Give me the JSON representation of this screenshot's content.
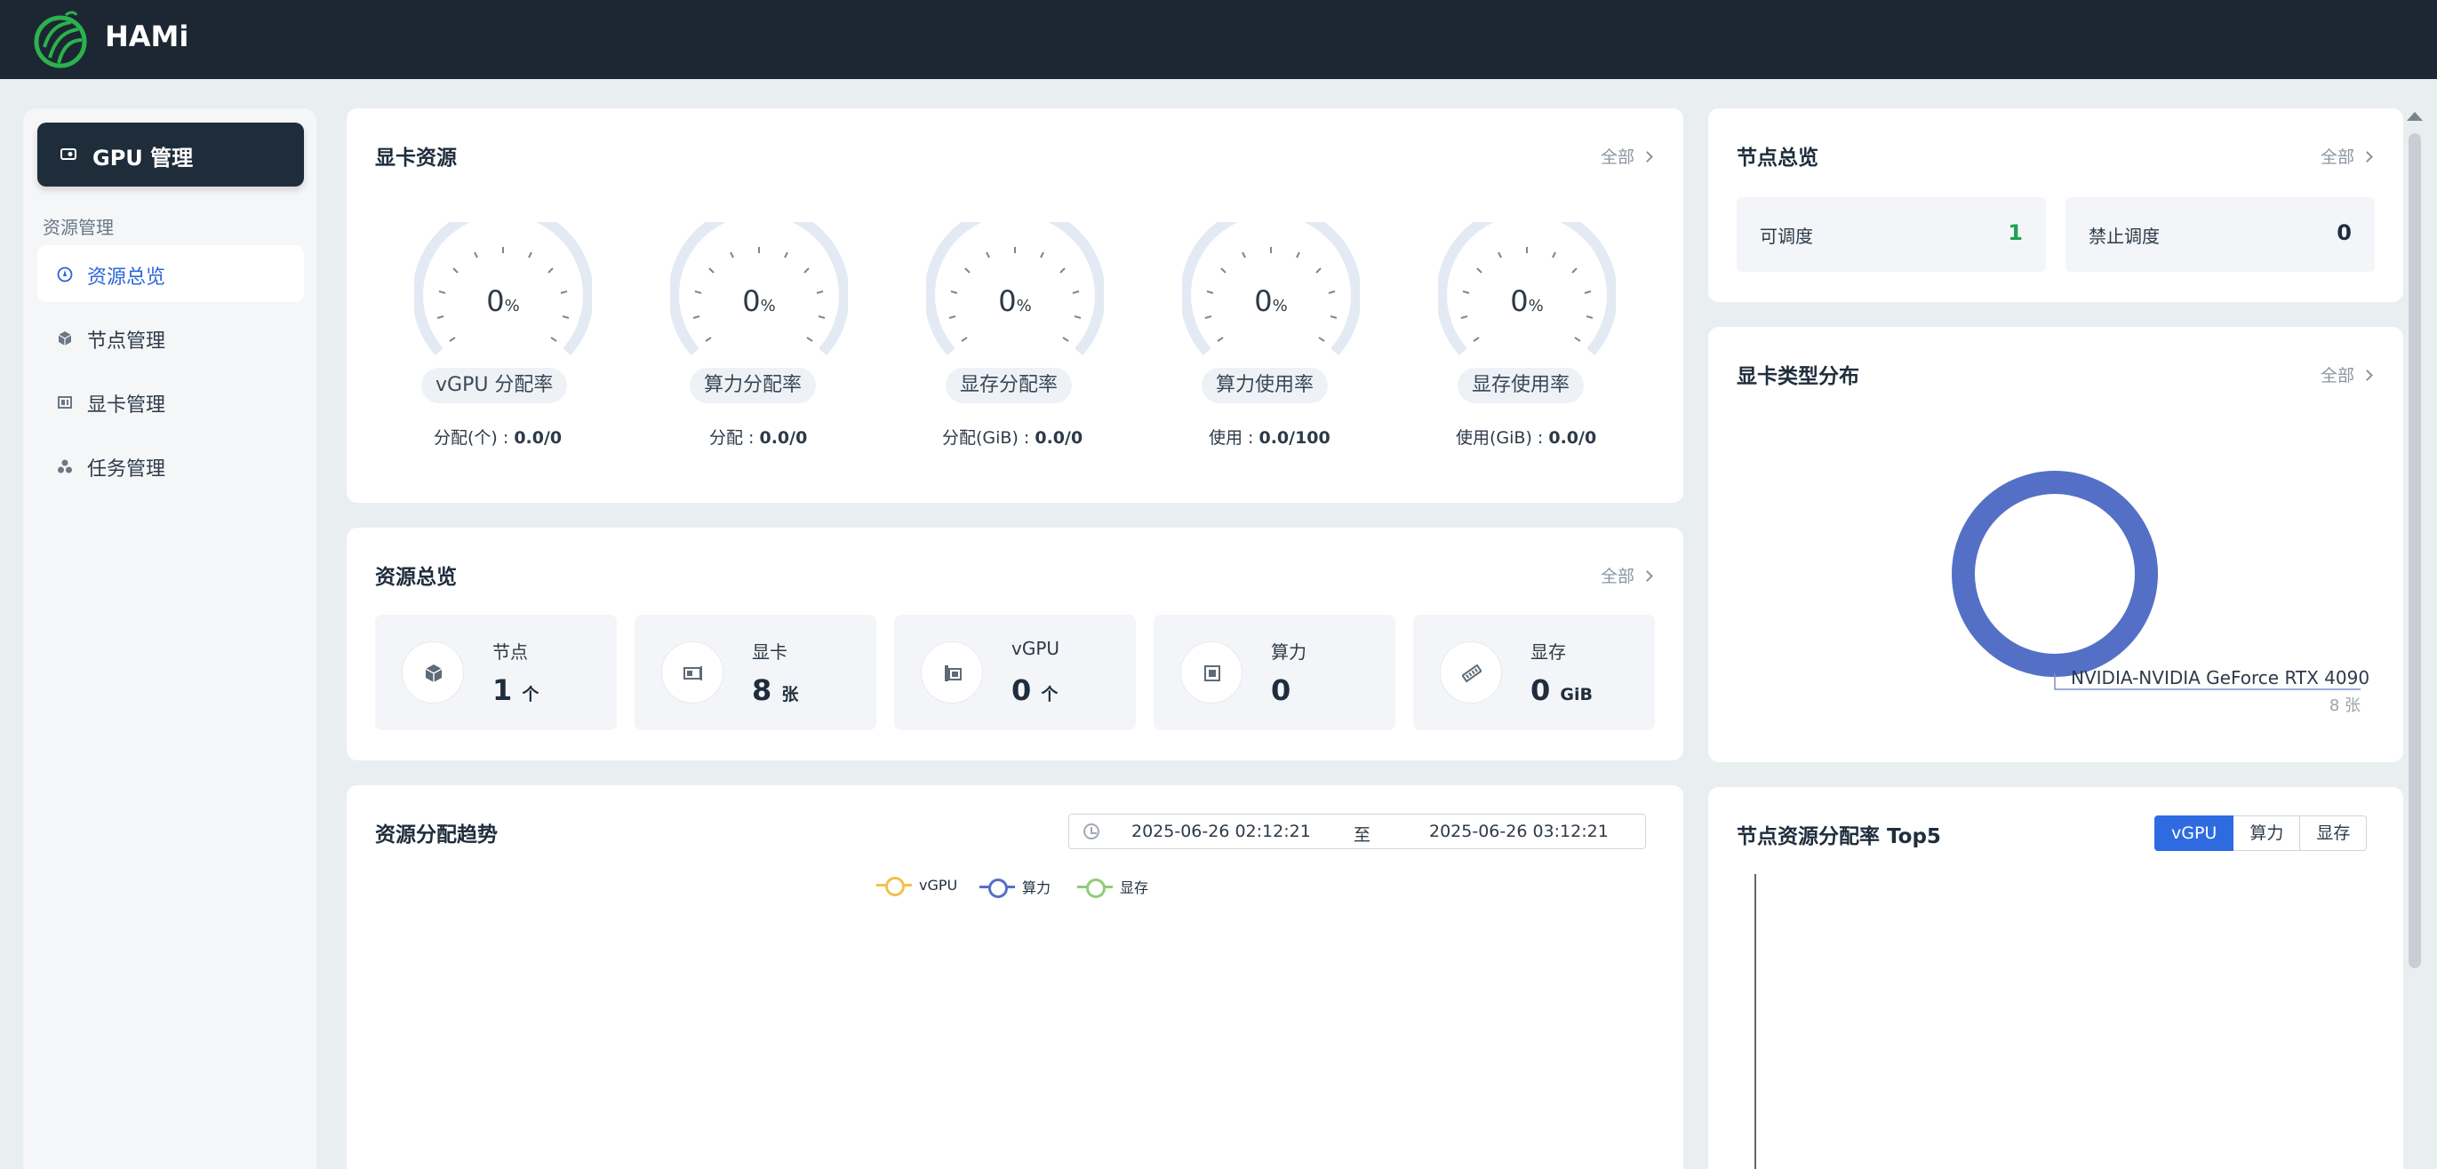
{
  "app": {
    "title": "HAMi"
  },
  "sidebar": {
    "main_button": "GPU 管理",
    "group_label": "资源管理",
    "items": [
      {
        "label": "资源总览",
        "icon": "dashboard-icon",
        "active": true
      },
      {
        "label": "节点管理",
        "icon": "node-cube-icon",
        "active": false
      },
      {
        "label": "显卡管理",
        "icon": "gpu-card-icon",
        "active": false
      },
      {
        "label": "任务管理",
        "icon": "task-icon",
        "active": false
      }
    ]
  },
  "gpu_resources": {
    "title": "显卡资源",
    "more": "全部",
    "gauges": [
      {
        "value": "0",
        "unit": "%",
        "label": "vGPU 分配率",
        "stat_label": "分配(个) : ",
        "stat_value": "0.0/0"
      },
      {
        "value": "0",
        "unit": "%",
        "label": "算力分配率",
        "stat_label": "分配 : ",
        "stat_value": "0.0/0"
      },
      {
        "value": "0",
        "unit": "%",
        "label": "显存分配率",
        "stat_label": "分配(GiB) : ",
        "stat_value": "0.0/0"
      },
      {
        "value": "0",
        "unit": "%",
        "label": "算力使用率",
        "stat_label": "使用 : ",
        "stat_value": "0.0/100"
      },
      {
        "value": "0",
        "unit": "%",
        "label": "显存使用率",
        "stat_label": "使用(GiB) : ",
        "stat_value": "0.0/0"
      }
    ]
  },
  "resource_overview": {
    "title": "资源总览",
    "more": "全部",
    "tiles": [
      {
        "label": "节点",
        "value": "1",
        "unit": "个",
        "icon": "node-cube-icon"
      },
      {
        "label": "显卡",
        "value": "8",
        "unit": "张",
        "icon": "gpu-card-icon"
      },
      {
        "label": "vGPU",
        "value": "0",
        "unit": "个",
        "icon": "vgpu-icon"
      },
      {
        "label": "算力",
        "value": "0",
        "unit": "",
        "icon": "chip-icon"
      },
      {
        "label": "显存",
        "value": "0",
        "unit": "GiB",
        "icon": "memory-icon"
      }
    ]
  },
  "trend": {
    "title": "资源分配趋势",
    "date_start": "2025-06-26 02:12:21",
    "date_to": "至",
    "date_end": "2025-06-26 03:12:21",
    "legend": [
      {
        "name": "vGPU",
        "color": "#f2c04e"
      },
      {
        "name": "算力",
        "color": "#5470c6"
      },
      {
        "name": "显存",
        "color": "#91cc75"
      }
    ]
  },
  "node_overview": {
    "title": "节点总览",
    "more": "全部",
    "stats": [
      {
        "label": "可调度",
        "value": "1",
        "color": "#20a14f"
      },
      {
        "label": "禁止调度",
        "value": "0",
        "color": "#1f2d3d"
      }
    ]
  },
  "gpu_type": {
    "title": "显卡类型分布",
    "more": "全部",
    "chart_data": {
      "type": "pie",
      "categories": [
        "NVIDIA-NVIDIA GeForce RTX 4090"
      ],
      "values": [
        8
      ],
      "labels": [
        "NVIDIA-NVIDIA GeForce RTX 4090"
      ],
      "value_labels": [
        "8 张"
      ],
      "colors": [
        "#5470c6"
      ]
    }
  },
  "top5": {
    "title": "节点资源分配率 Top5",
    "tabs": [
      "vGPU",
      "算力",
      "显存"
    ],
    "active_tab": 0
  }
}
